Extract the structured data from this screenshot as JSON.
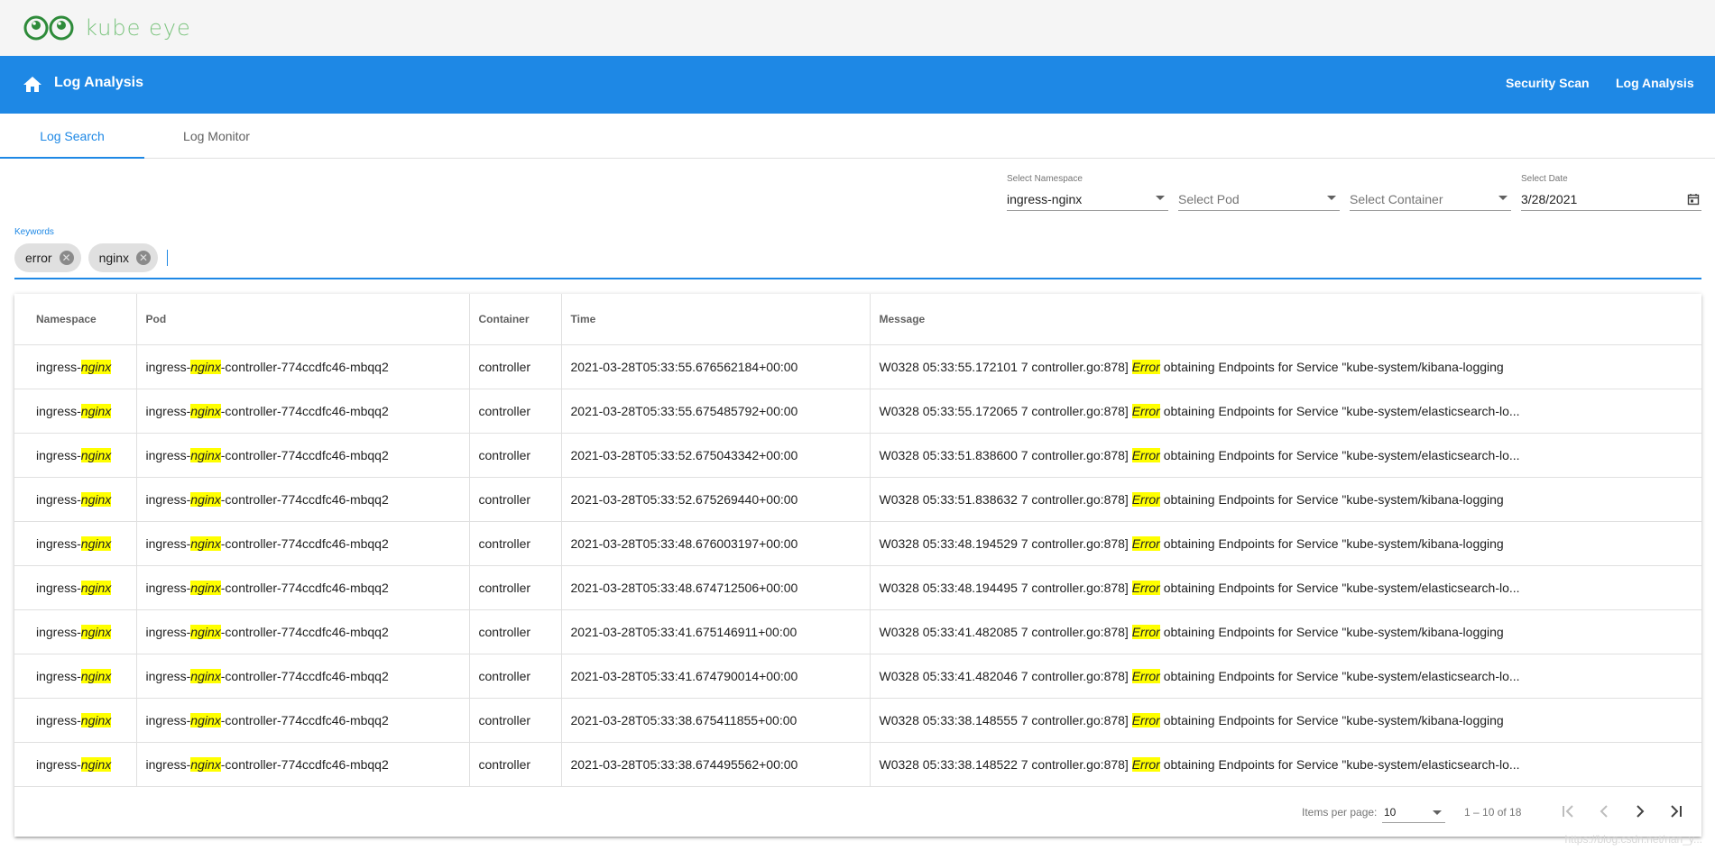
{
  "brand": {
    "logo_text": "kube eye"
  },
  "toolbar": {
    "title": "Log Analysis",
    "nav": [
      "Security Scan",
      "Log Analysis"
    ]
  },
  "tabs": [
    {
      "label": "Log Search",
      "active": true
    },
    {
      "label": "Log Monitor",
      "active": false
    }
  ],
  "filters": {
    "namespace": {
      "label": "Select Namespace",
      "value": "ingress-nginx"
    },
    "pod": {
      "placeholder": "Select Pod"
    },
    "container": {
      "placeholder": "Select Container"
    },
    "date": {
      "label": "Select Date",
      "value": "3/28/2021"
    }
  },
  "keywords": {
    "label": "Keywords",
    "chips": [
      "error",
      "nginx"
    ]
  },
  "table": {
    "columns": [
      "Namespace",
      "Pod",
      "Container",
      "Time",
      "Message"
    ],
    "rows": [
      {
        "namespace": [
          "ingress-",
          "nginx",
          ""
        ],
        "pod": [
          "ingress-",
          "nginx",
          "-controller-774ccdfc46-mbqq2"
        ],
        "container": "controller",
        "time": "2021-03-28T05:33:55.676562184+00:00",
        "message": [
          "W0328 05:33:55.172101 7 controller.go:878] ",
          "Error",
          " obtaining Endpoints for Service \"kube-system/kibana-logging"
        ]
      },
      {
        "namespace": [
          "ingress-",
          "nginx",
          ""
        ],
        "pod": [
          "ingress-",
          "nginx",
          "-controller-774ccdfc46-mbqq2"
        ],
        "container": "controller",
        "time": "2021-03-28T05:33:55.675485792+00:00",
        "message": [
          "W0328 05:33:55.172065 7 controller.go:878] ",
          "Error",
          " obtaining Endpoints for Service \"kube-system/elasticsearch-lo..."
        ]
      },
      {
        "namespace": [
          "ingress-",
          "nginx",
          ""
        ],
        "pod": [
          "ingress-",
          "nginx",
          "-controller-774ccdfc46-mbqq2"
        ],
        "container": "controller",
        "time": "2021-03-28T05:33:52.675043342+00:00",
        "message": [
          "W0328 05:33:51.838600 7 controller.go:878] ",
          "Error",
          " obtaining Endpoints for Service \"kube-system/elasticsearch-lo..."
        ]
      },
      {
        "namespace": [
          "ingress-",
          "nginx",
          ""
        ],
        "pod": [
          "ingress-",
          "nginx",
          "-controller-774ccdfc46-mbqq2"
        ],
        "container": "controller",
        "time": "2021-03-28T05:33:52.675269440+00:00",
        "message": [
          "W0328 05:33:51.838632 7 controller.go:878] ",
          "Error",
          " obtaining Endpoints for Service \"kube-system/kibana-logging"
        ]
      },
      {
        "namespace": [
          "ingress-",
          "nginx",
          ""
        ],
        "pod": [
          "ingress-",
          "nginx",
          "-controller-774ccdfc46-mbqq2"
        ],
        "container": "controller",
        "time": "2021-03-28T05:33:48.676003197+00:00",
        "message": [
          "W0328 05:33:48.194529 7 controller.go:878] ",
          "Error",
          " obtaining Endpoints for Service \"kube-system/kibana-logging"
        ]
      },
      {
        "namespace": [
          "ingress-",
          "nginx",
          ""
        ],
        "pod": [
          "ingress-",
          "nginx",
          "-controller-774ccdfc46-mbqq2"
        ],
        "container": "controller",
        "time": "2021-03-28T05:33:48.674712506+00:00",
        "message": [
          "W0328 05:33:48.194495 7 controller.go:878] ",
          "Error",
          " obtaining Endpoints for Service \"kube-system/elasticsearch-lo..."
        ]
      },
      {
        "namespace": [
          "ingress-",
          "nginx",
          ""
        ],
        "pod": [
          "ingress-",
          "nginx",
          "-controller-774ccdfc46-mbqq2"
        ],
        "container": "controller",
        "time": "2021-03-28T05:33:41.675146911+00:00",
        "message": [
          "W0328 05:33:41.482085 7 controller.go:878] ",
          "Error",
          " obtaining Endpoints for Service \"kube-system/kibana-logging"
        ]
      },
      {
        "namespace": [
          "ingress-",
          "nginx",
          ""
        ],
        "pod": [
          "ingress-",
          "nginx",
          "-controller-774ccdfc46-mbqq2"
        ],
        "container": "controller",
        "time": "2021-03-28T05:33:41.674790014+00:00",
        "message": [
          "W0328 05:33:41.482046 7 controller.go:878] ",
          "Error",
          " obtaining Endpoints for Service \"kube-system/elasticsearch-lo..."
        ]
      },
      {
        "namespace": [
          "ingress-",
          "nginx",
          ""
        ],
        "pod": [
          "ingress-",
          "nginx",
          "-controller-774ccdfc46-mbqq2"
        ],
        "container": "controller",
        "time": "2021-03-28T05:33:38.675411855+00:00",
        "message": [
          "W0328 05:33:38.148555 7 controller.go:878] ",
          "Error",
          " obtaining Endpoints for Service \"kube-system/kibana-logging"
        ]
      },
      {
        "namespace": [
          "ingress-",
          "nginx",
          ""
        ],
        "pod": [
          "ingress-",
          "nginx",
          "-controller-774ccdfc46-mbqq2"
        ],
        "container": "controller",
        "time": "2021-03-28T05:33:38.674495562+00:00",
        "message": [
          "W0328 05:33:38.148522 7 controller.go:878] ",
          "Error",
          " obtaining Endpoints for Service \"kube-system/elasticsearch-lo..."
        ]
      }
    ]
  },
  "paginator": {
    "items_per_page_label": "Items per page:",
    "items_per_page": "10",
    "range_label": "1 – 10 of 18",
    "first_disabled": true,
    "prev_disabled": true
  },
  "watermark": "https://blog.csdn.net/nan_y..."
}
